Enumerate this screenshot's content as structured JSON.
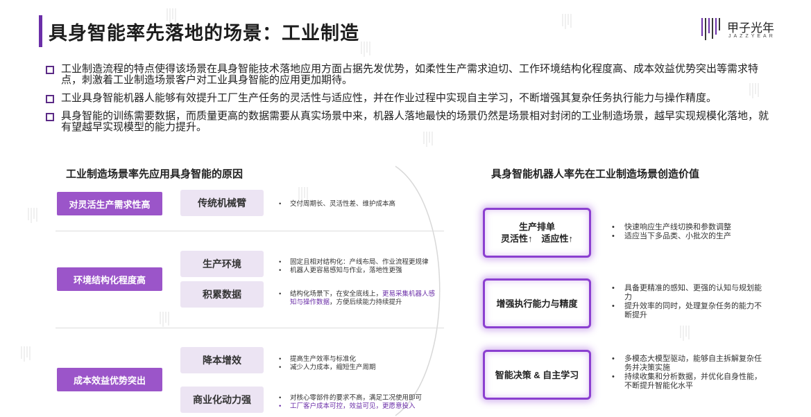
{
  "header": {
    "title": "具身智能率先落地的场景：工业制造",
    "logo_cn": "甲子光年",
    "logo_en": "JAZZYEAR"
  },
  "bullets": [
    "工业制造流程的特点使得该场景在具身智能技术落地应用方面占据先发优势，如柔性生产需求迫切、工作环境结构化程度高、成本效益优势突出等需求特点，刺激着工业制造场景客户对工业具身智能的应用更加期待。",
    "工业具身智能机器人能够有效提升工厂生产任务的灵活性与适应性，并在作业过程中实现自主学习，不断增强其复杂任务执行能力与操作精度。",
    "具身智能的训练需要数据，而质量更高的数据需要从真实场景中来，机器人落地最快的场景仍然是场景相对封闭的工业制造场景，越早实现规模化落地，就有望越早实现模型的能力提升。"
  ],
  "left": {
    "title": "工业制造场景率先应用具身智能的原因",
    "groups": [
      {
        "label": "对灵活生产需求性高",
        "items": [
          {
            "label": "传统机械臂",
            "notes": [
              "交付周期长、灵活性差、维护成本高"
            ]
          }
        ]
      },
      {
        "label": "环境结构化程度高",
        "items": [
          {
            "label": "生产环境",
            "notes": [
              "固定且相对结构化：产线布局、作业流程更规律",
              "机器人更容易感知与作业，落地性更强"
            ]
          },
          {
            "label": "积累数据",
            "note_a": "结构化场景下，在安全底线上，",
            "note_hl": "更易采集机器人感知与操作数据",
            "note_b": "，方便后续能力持续提升"
          }
        ]
      },
      {
        "label": "成本效益优势突出",
        "items": [
          {
            "label": "降本增效",
            "notes": [
              "提高生产效率与标准化",
              "减少人力成本，缩短生产周期"
            ]
          },
          {
            "label": "商业化动力强",
            "notes": [
              "对核心零部件的要求不高，满足工况使用即可"
            ],
            "note_hl": "工厂客户成本可控，效益可见，更愿意投入"
          }
        ]
      }
    ]
  },
  "right": {
    "title": "具身智能机器人率先在工业制造场景创造价值",
    "items": [
      {
        "label_line1": "生产排单",
        "label_line2": "灵活性↑　适应性↑",
        "notes": [
          "快速响应生产线切换和参数调整",
          "适应当下多品类、小批次的生产"
        ]
      },
      {
        "label_line1": "增强执行能力与精度",
        "notes": [
          "具备更精准的感知、更强的认知与规划能力",
          "提升效率的同时，处理复杂任务的能力不断提升"
        ]
      },
      {
        "label_line1": "智能决策 & 自主学习",
        "notes": [
          "多模态大模型驱动，能够自主拆解复杂任务并决策实施",
          "持续收集和分析数据，并优化自身性能，不断提升智能化水平"
        ]
      }
    ]
  },
  "colors": {
    "accent": "#6b2fa8",
    "label_purple": "#9b55c9",
    "label_light": "#ece4f3",
    "glow": "#8b3fd0"
  },
  "icons": {
    "bullet": "square-bullet-icon",
    "logo": "jazzyear-logo-icon"
  }
}
